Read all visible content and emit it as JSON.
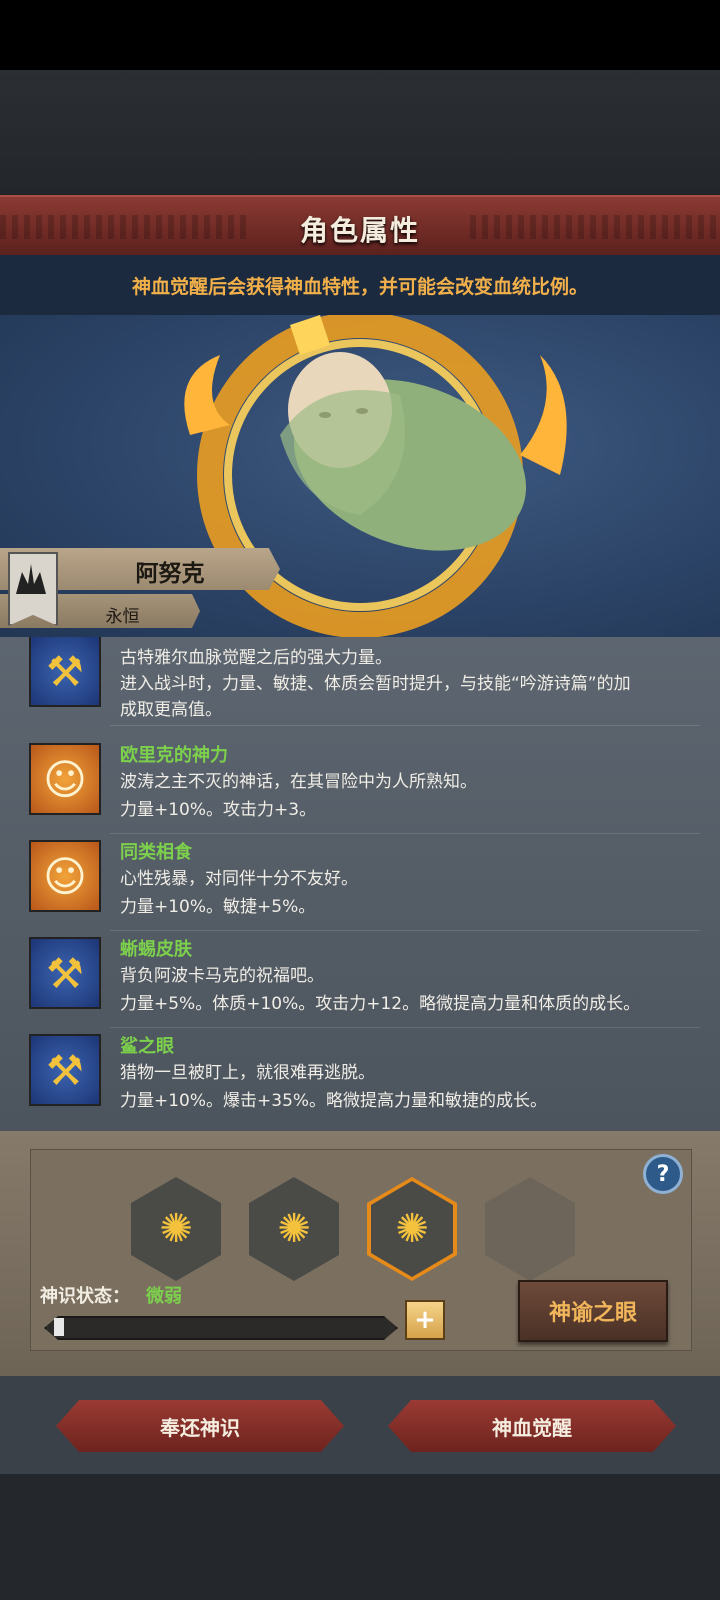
{
  "header": {
    "title": "角色属性",
    "subtitle": "神血觉醒后会获得神血特性，并可能会改变血统比例。"
  },
  "character": {
    "name": "阿努克",
    "rank": "永恒"
  },
  "traits": [
    {
      "name": "",
      "icon": "axe-icon",
      "lines": [
        "古特雅尔血脉觉醒之后的强大力量。",
        "进入战斗时，力量、敏捷、体质会暂时提升，与技能“吟游诗篇”的加",
        "成取更高值。"
      ]
    },
    {
      "name": "欧里克的神力",
      "icon": "smile-icon",
      "lines": [
        "波涛之主不灭的神话，在其冒险中为人所熟知。",
        "力量+10%。攻击力+3。"
      ]
    },
    {
      "name": "同类相食",
      "icon": "smile-icon",
      "lines": [
        "心性残暴，对同伴十分不友好。",
        "力量+10%。敏捷+5%。"
      ]
    },
    {
      "name": "蜥蜴皮肤",
      "icon": "axe-icon",
      "lines": [
        "背负阿波卡马克的祝福吧。",
        "力量+5%。体质+10%。攻击力+12。略微提高力量和体质的成长。"
      ]
    },
    {
      "name": "鲨之眼",
      "icon": "axe-icon",
      "lines": [
        "猎物一旦被盯上，就很难再逃脱。",
        "力量+10%。爆击+35%。略微提高力量和敏捷的成长。"
      ]
    }
  ],
  "awaken": {
    "status_label": "神识状态：",
    "status_value": "微弱",
    "progress": 0.03,
    "oracle_label": "神谕之眼",
    "help": "?"
  },
  "footer": {
    "return_label": "奉还神识",
    "awaken_label": "神血觉醒"
  }
}
